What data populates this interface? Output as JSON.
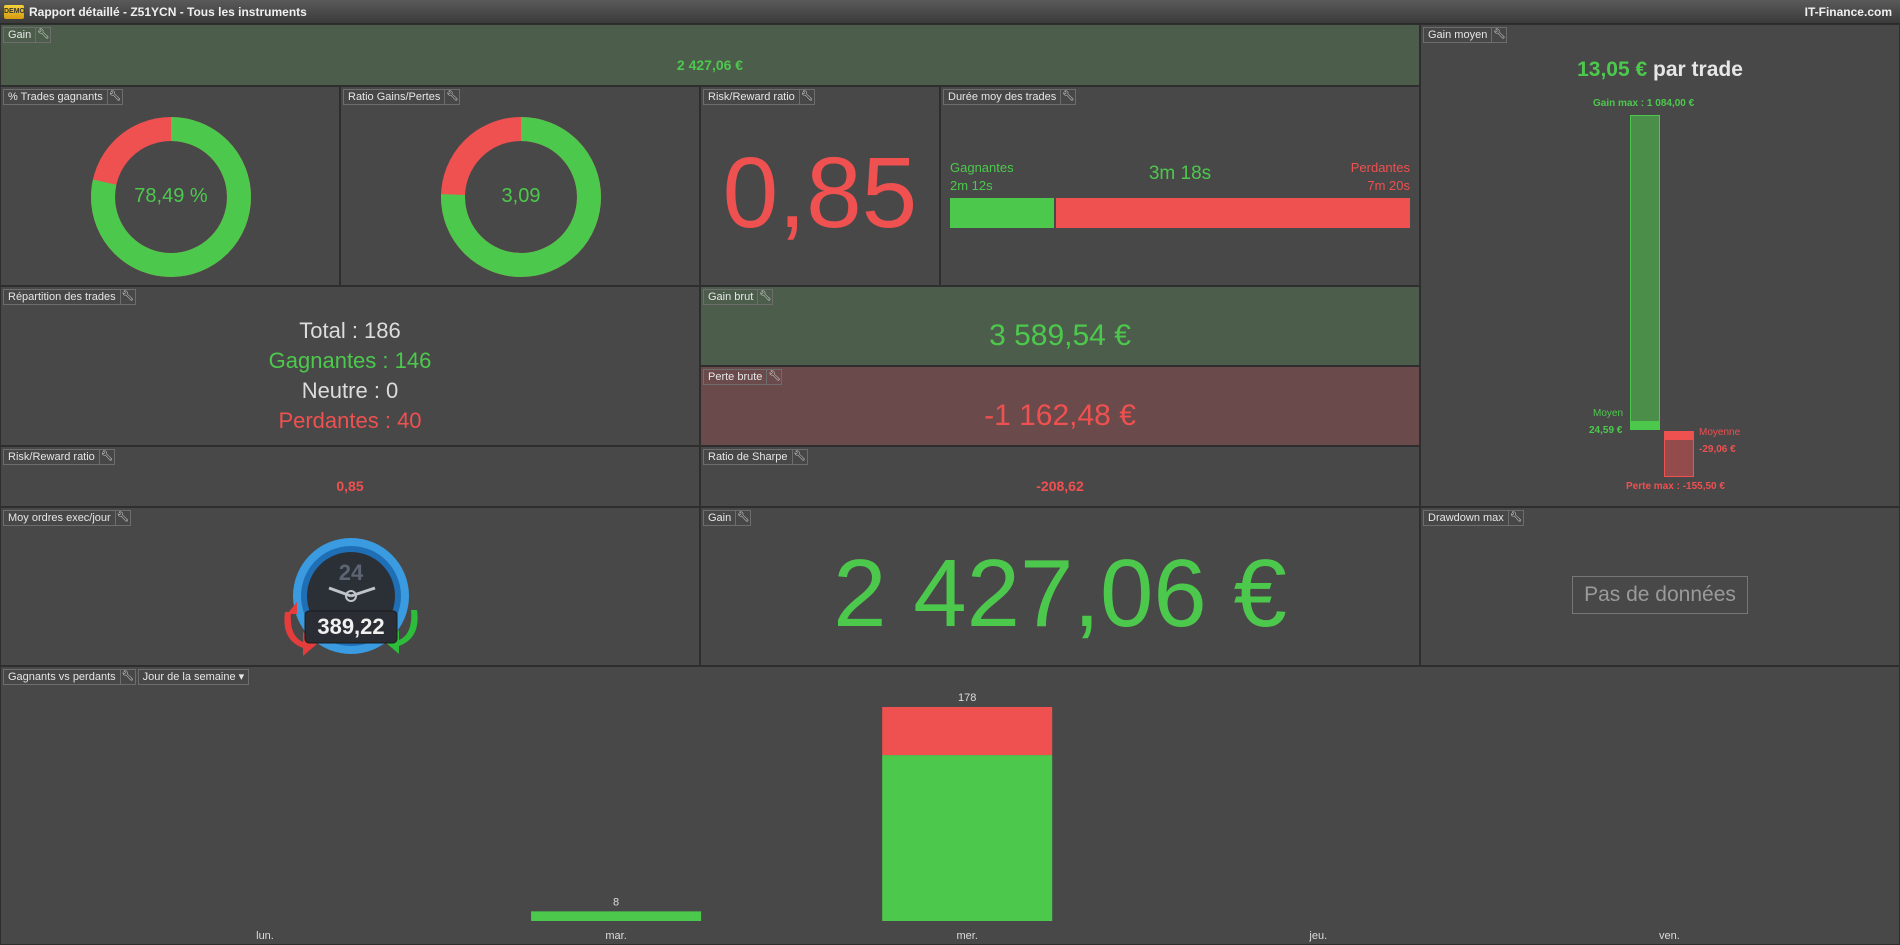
{
  "window": {
    "title": "Rapport détaillé - Z51YCN - Tous les instruments",
    "brand": "IT-Finance.com",
    "logo_text": "DEMO"
  },
  "colors": {
    "green": "#4cc94c",
    "red": "#ef5050",
    "background": "#474747"
  },
  "icons": {
    "settings": "wrench-icon",
    "dropdown": "caret-down-icon"
  },
  "gain_top": {
    "label": "Gain",
    "value": "2 427,06 €"
  },
  "gain_moyen": {
    "label": "Gain moyen",
    "value": "13,05 €",
    "suffix": "par trade",
    "gain_max_label": "Gain max :",
    "gain_max_value": "1 084,00 €",
    "moyen_label": "Moyen",
    "moyen_value": "24,59 €",
    "moyenne_label": "Moyenne",
    "moyenne_value": "-29,06 €",
    "perte_max_label": "Perte max :",
    "perte_max_value": "-155,50 €"
  },
  "pct_trades_gagnants": {
    "label": "% Trades gagnants",
    "value": "78,49 %",
    "fraction": 0.7849
  },
  "ratio_gains_pertes": {
    "label": "Ratio Gains/Pertes",
    "value": "3,09",
    "fraction": 0.7555
  },
  "risk_reward": {
    "label": "Risk/Reward ratio",
    "value": "0,85"
  },
  "duree_moy": {
    "label": "Durée moy des trades",
    "gagnantes_label": "Gagnantes",
    "gagnantes_value": "2m 12s",
    "total_value": "3m 18s",
    "perdantes_label": "Perdantes",
    "perdantes_value": "7m 20s",
    "win_fraction": 0.23
  },
  "repartition": {
    "label": "Répartition des trades",
    "total": "Total : 186",
    "gagnantes": "Gagnantes : 146",
    "neutre": "Neutre : 0",
    "perdantes": "Perdantes : 40"
  },
  "gain_brut": {
    "label": "Gain brut",
    "value": "3 589,54 €"
  },
  "perte_brute": {
    "label": "Perte brute",
    "value": "-1 162,48 €"
  },
  "risk_reward_small": {
    "label": "Risk/Reward ratio",
    "value": "0,85"
  },
  "ratio_sharpe": {
    "label": "Ratio de Sharpe",
    "value": "-208,62"
  },
  "moy_ordres": {
    "label": "Moy ordres exec/jour",
    "value": "389,22",
    "clock_label": "24"
  },
  "gain_big": {
    "label": "Gain",
    "value": "2 427,06 €"
  },
  "drawdown": {
    "label": "Drawdown max",
    "no_data": "Pas de données"
  },
  "gagnants_vs_perdants": {
    "label": "Gagnants vs perdants",
    "dropdown": "Jour de la semaine"
  },
  "chart_data": {
    "type": "bar",
    "stacked": true,
    "categories": [
      "lun.",
      "mar.",
      "mer.",
      "jeu.",
      "ven."
    ],
    "series": [
      {
        "values": [
          0,
          8,
          138,
          0,
          0
        ],
        "color": "#4cc94c"
      },
      {
        "values": [
          0,
          0,
          40,
          0,
          0
        ],
        "color": "#ef5050"
      }
    ],
    "totals": [
      null,
      8,
      178,
      null,
      null
    ],
    "ylim": [
      0,
      178
    ],
    "grid": false,
    "legend": "none"
  }
}
